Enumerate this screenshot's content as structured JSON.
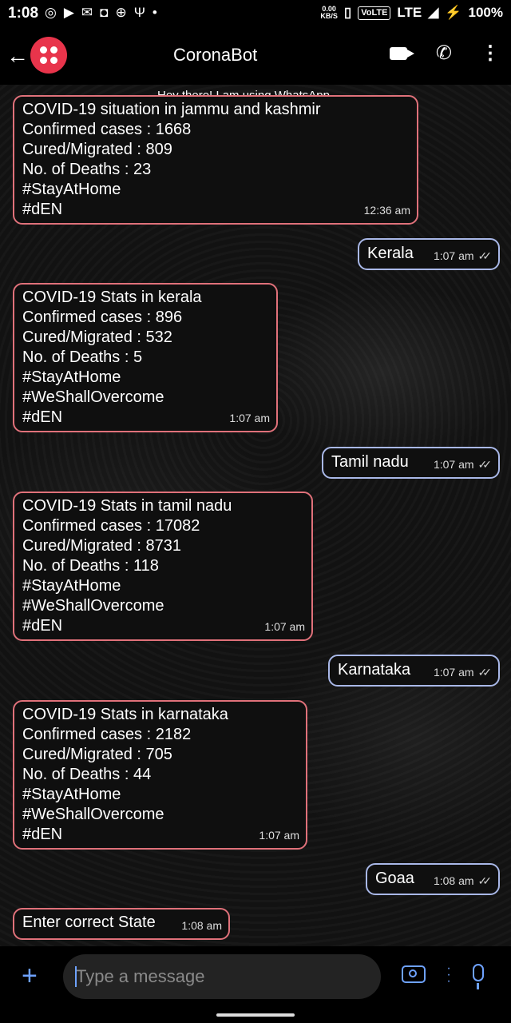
{
  "status_bar": {
    "time": "1:08",
    "data_speed": "0.00",
    "data_unit": "KB/S",
    "volte": "VoLTE",
    "network": "LTE",
    "battery": "100%"
  },
  "header": {
    "chat_name": "CoronaBot",
    "contact_status": "Hey there! I am using WhatsApp.",
    "avatar_color": "#e8344b"
  },
  "messages": [
    {
      "direction": "in",
      "lines": [
        "COVID-19 situation in jammu and kashmir",
        "Confirmed cases : 1668",
        "Cured/Migrated : 809",
        "No. of Deaths : 23",
        "#StayAtHome",
        "#dEN"
      ],
      "time": "12:36 am"
    },
    {
      "direction": "out",
      "lines": [
        "Kerala"
      ],
      "time": "1:07 am"
    },
    {
      "direction": "in",
      "lines": [
        "COVID-19 Stats in kerala",
        "Confirmed cases : 896",
        "Cured/Migrated : 532",
        "No. of Deaths : 5",
        "#StayAtHome",
        "#WeShallOvercome",
        "#dEN"
      ],
      "time": "1:07 am"
    },
    {
      "direction": "out",
      "lines": [
        "Tamil nadu"
      ],
      "time": "1:07 am"
    },
    {
      "direction": "in",
      "lines": [
        "COVID-19 Stats in tamil nadu",
        "Confirmed cases : 17082",
        "Cured/Migrated : 8731",
        "No. of Deaths : 118",
        "#StayAtHome",
        "#WeShallOvercome",
        "#dEN"
      ],
      "time": "1:07 am"
    },
    {
      "direction": "out",
      "lines": [
        "Karnataka"
      ],
      "time": "1:07 am"
    },
    {
      "direction": "in",
      "lines": [
        "COVID-19 Stats in karnataka",
        "Confirmed cases : 2182",
        "Cured/Migrated : 705",
        "No. of Deaths : 44",
        "#StayAtHome",
        "#WeShallOvercome",
        "#dEN"
      ],
      "time": "1:07 am"
    },
    {
      "direction": "out",
      "lines": [
        "Goaa"
      ],
      "time": "1:08 am"
    },
    {
      "direction": "in",
      "lines": [
        "Enter correct State"
      ],
      "time": "1:08 am"
    }
  ],
  "composer": {
    "placeholder": "Type a message",
    "accent_color": "#6ea2ff"
  },
  "colors": {
    "incoming_border": "#e0717a",
    "outgoing_border": "#a9b8e8"
  }
}
